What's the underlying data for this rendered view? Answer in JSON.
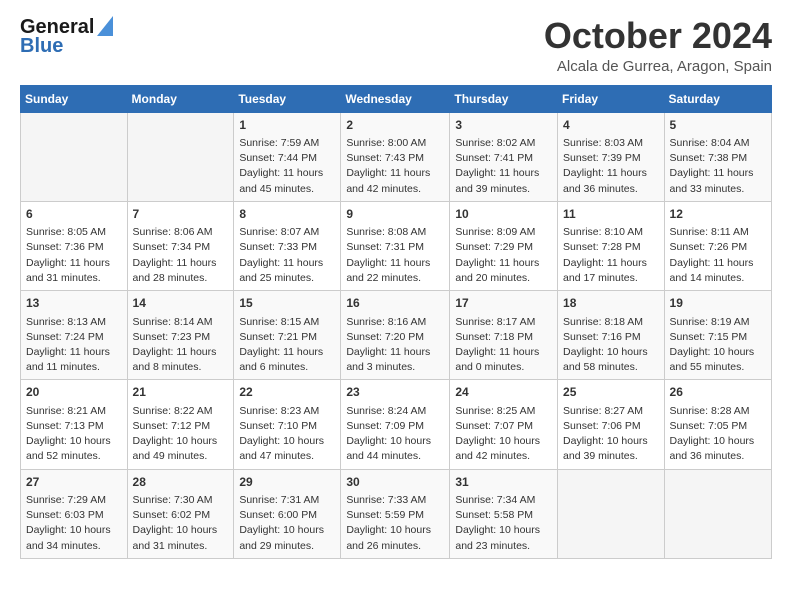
{
  "header": {
    "logo_general": "General",
    "logo_blue": "Blue",
    "month": "October 2024",
    "location": "Alcala de Gurrea, Aragon, Spain"
  },
  "days_of_week": [
    "Sunday",
    "Monday",
    "Tuesday",
    "Wednesday",
    "Thursday",
    "Friday",
    "Saturday"
  ],
  "weeks": [
    [
      {
        "day": "",
        "sunrise": "",
        "sunset": "",
        "daylight": ""
      },
      {
        "day": "",
        "sunrise": "",
        "sunset": "",
        "daylight": ""
      },
      {
        "day": "1",
        "sunrise": "Sunrise: 7:59 AM",
        "sunset": "Sunset: 7:44 PM",
        "daylight": "Daylight: 11 hours and 45 minutes."
      },
      {
        "day": "2",
        "sunrise": "Sunrise: 8:00 AM",
        "sunset": "Sunset: 7:43 PM",
        "daylight": "Daylight: 11 hours and 42 minutes."
      },
      {
        "day": "3",
        "sunrise": "Sunrise: 8:02 AM",
        "sunset": "Sunset: 7:41 PM",
        "daylight": "Daylight: 11 hours and 39 minutes."
      },
      {
        "day": "4",
        "sunrise": "Sunrise: 8:03 AM",
        "sunset": "Sunset: 7:39 PM",
        "daylight": "Daylight: 11 hours and 36 minutes."
      },
      {
        "day": "5",
        "sunrise": "Sunrise: 8:04 AM",
        "sunset": "Sunset: 7:38 PM",
        "daylight": "Daylight: 11 hours and 33 minutes."
      }
    ],
    [
      {
        "day": "6",
        "sunrise": "Sunrise: 8:05 AM",
        "sunset": "Sunset: 7:36 PM",
        "daylight": "Daylight: 11 hours and 31 minutes."
      },
      {
        "day": "7",
        "sunrise": "Sunrise: 8:06 AM",
        "sunset": "Sunset: 7:34 PM",
        "daylight": "Daylight: 11 hours and 28 minutes."
      },
      {
        "day": "8",
        "sunrise": "Sunrise: 8:07 AM",
        "sunset": "Sunset: 7:33 PM",
        "daylight": "Daylight: 11 hours and 25 minutes."
      },
      {
        "day": "9",
        "sunrise": "Sunrise: 8:08 AM",
        "sunset": "Sunset: 7:31 PM",
        "daylight": "Daylight: 11 hours and 22 minutes."
      },
      {
        "day": "10",
        "sunrise": "Sunrise: 8:09 AM",
        "sunset": "Sunset: 7:29 PM",
        "daylight": "Daylight: 11 hours and 20 minutes."
      },
      {
        "day": "11",
        "sunrise": "Sunrise: 8:10 AM",
        "sunset": "Sunset: 7:28 PM",
        "daylight": "Daylight: 11 hours and 17 minutes."
      },
      {
        "day": "12",
        "sunrise": "Sunrise: 8:11 AM",
        "sunset": "Sunset: 7:26 PM",
        "daylight": "Daylight: 11 hours and 14 minutes."
      }
    ],
    [
      {
        "day": "13",
        "sunrise": "Sunrise: 8:13 AM",
        "sunset": "Sunset: 7:24 PM",
        "daylight": "Daylight: 11 hours and 11 minutes."
      },
      {
        "day": "14",
        "sunrise": "Sunrise: 8:14 AM",
        "sunset": "Sunset: 7:23 PM",
        "daylight": "Daylight: 11 hours and 8 minutes."
      },
      {
        "day": "15",
        "sunrise": "Sunrise: 8:15 AM",
        "sunset": "Sunset: 7:21 PM",
        "daylight": "Daylight: 11 hours and 6 minutes."
      },
      {
        "day": "16",
        "sunrise": "Sunrise: 8:16 AM",
        "sunset": "Sunset: 7:20 PM",
        "daylight": "Daylight: 11 hours and 3 minutes."
      },
      {
        "day": "17",
        "sunrise": "Sunrise: 8:17 AM",
        "sunset": "Sunset: 7:18 PM",
        "daylight": "Daylight: 11 hours and 0 minutes."
      },
      {
        "day": "18",
        "sunrise": "Sunrise: 8:18 AM",
        "sunset": "Sunset: 7:16 PM",
        "daylight": "Daylight: 10 hours and 58 minutes."
      },
      {
        "day": "19",
        "sunrise": "Sunrise: 8:19 AM",
        "sunset": "Sunset: 7:15 PM",
        "daylight": "Daylight: 10 hours and 55 minutes."
      }
    ],
    [
      {
        "day": "20",
        "sunrise": "Sunrise: 8:21 AM",
        "sunset": "Sunset: 7:13 PM",
        "daylight": "Daylight: 10 hours and 52 minutes."
      },
      {
        "day": "21",
        "sunrise": "Sunrise: 8:22 AM",
        "sunset": "Sunset: 7:12 PM",
        "daylight": "Daylight: 10 hours and 49 minutes."
      },
      {
        "day": "22",
        "sunrise": "Sunrise: 8:23 AM",
        "sunset": "Sunset: 7:10 PM",
        "daylight": "Daylight: 10 hours and 47 minutes."
      },
      {
        "day": "23",
        "sunrise": "Sunrise: 8:24 AM",
        "sunset": "Sunset: 7:09 PM",
        "daylight": "Daylight: 10 hours and 44 minutes."
      },
      {
        "day": "24",
        "sunrise": "Sunrise: 8:25 AM",
        "sunset": "Sunset: 7:07 PM",
        "daylight": "Daylight: 10 hours and 42 minutes."
      },
      {
        "day": "25",
        "sunrise": "Sunrise: 8:27 AM",
        "sunset": "Sunset: 7:06 PM",
        "daylight": "Daylight: 10 hours and 39 minutes."
      },
      {
        "day": "26",
        "sunrise": "Sunrise: 8:28 AM",
        "sunset": "Sunset: 7:05 PM",
        "daylight": "Daylight: 10 hours and 36 minutes."
      }
    ],
    [
      {
        "day": "27",
        "sunrise": "Sunrise: 7:29 AM",
        "sunset": "Sunset: 6:03 PM",
        "daylight": "Daylight: 10 hours and 34 minutes."
      },
      {
        "day": "28",
        "sunrise": "Sunrise: 7:30 AM",
        "sunset": "Sunset: 6:02 PM",
        "daylight": "Daylight: 10 hours and 31 minutes."
      },
      {
        "day": "29",
        "sunrise": "Sunrise: 7:31 AM",
        "sunset": "Sunset: 6:00 PM",
        "daylight": "Daylight: 10 hours and 29 minutes."
      },
      {
        "day": "30",
        "sunrise": "Sunrise: 7:33 AM",
        "sunset": "Sunset: 5:59 PM",
        "daylight": "Daylight: 10 hours and 26 minutes."
      },
      {
        "day": "31",
        "sunrise": "Sunrise: 7:34 AM",
        "sunset": "Sunset: 5:58 PM",
        "daylight": "Daylight: 10 hours and 23 minutes."
      },
      {
        "day": "",
        "sunrise": "",
        "sunset": "",
        "daylight": ""
      },
      {
        "day": "",
        "sunrise": "",
        "sunset": "",
        "daylight": ""
      }
    ]
  ]
}
